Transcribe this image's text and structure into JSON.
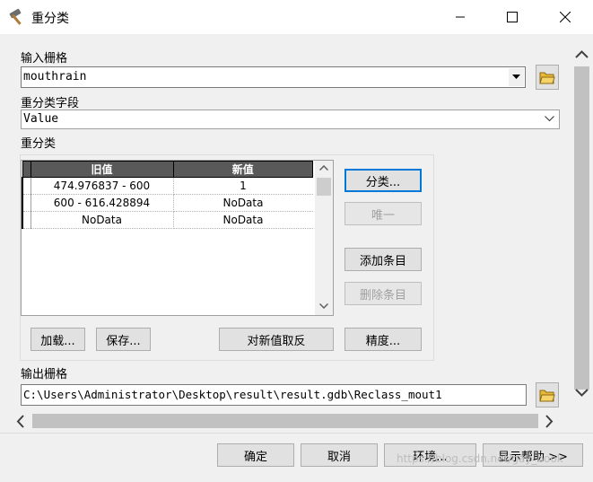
{
  "window": {
    "title": "重分类"
  },
  "input_raster": {
    "label": "输入栅格",
    "value": "mouthrain"
  },
  "reclass_field": {
    "label": "重分类字段",
    "value": "Value"
  },
  "reclassification": {
    "label": "重分类",
    "columns": [
      "旧值",
      "新值"
    ],
    "rows": [
      {
        "old": "474.976837 - 600",
        "new": "1"
      },
      {
        "old": "600 - 616.428894",
        "new": "NoData"
      },
      {
        "old": "NoData",
        "new": "NoData"
      }
    ],
    "buttons": {
      "classify": "分类...",
      "unique": "唯一",
      "add_entry": "添加条目",
      "delete_entry": "删除条目",
      "load": "加载...",
      "save": "保存...",
      "reverse": "对新值取反",
      "precision": "精度..."
    }
  },
  "output_raster": {
    "label": "输出栅格",
    "value": "C:\\Users\\Administrator\\Desktop\\result\\result.gdb\\Reclass_mout1"
  },
  "footer": {
    "ok": "确定",
    "cancel": "取消",
    "environments": "环境...",
    "show_help": "显示帮助 >>",
    "watermark": "https://blog.csdn.net/gay_book"
  }
}
